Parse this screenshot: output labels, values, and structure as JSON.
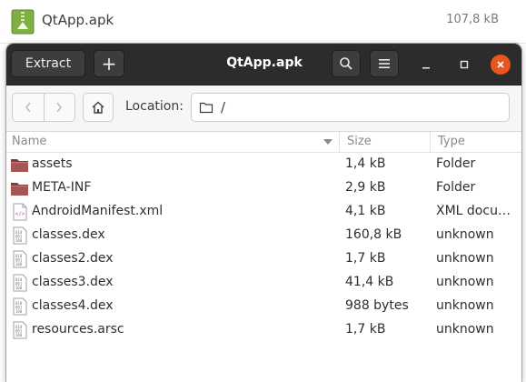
{
  "background_file": {
    "name": "QtApp.apk",
    "size": "107,8 kB"
  },
  "window": {
    "title": "QtApp.apk",
    "extract_label": "Extract",
    "add_label": "+"
  },
  "location": {
    "label": "Location:",
    "path": "/"
  },
  "columns": {
    "name": "Name",
    "size": "Size",
    "type": "Type"
  },
  "files": [
    {
      "name": "assets",
      "size": "1,4 kB",
      "type": "Folder",
      "icon": "folder-icon"
    },
    {
      "name": "META-INF",
      "size": "2,9 kB",
      "type": "Folder",
      "icon": "folder-icon"
    },
    {
      "name": "AndroidManifest.xml",
      "size": "4,1 kB",
      "type": "XML docu…",
      "icon": "xml-file-icon"
    },
    {
      "name": "classes.dex",
      "size": "160,8 kB",
      "type": "unknown",
      "icon": "binary-file-icon"
    },
    {
      "name": "classes2.dex",
      "size": "1,7 kB",
      "type": "unknown",
      "icon": "binary-file-icon"
    },
    {
      "name": "classes3.dex",
      "size": "41,4 kB",
      "type": "unknown",
      "icon": "binary-file-icon"
    },
    {
      "name": "classes4.dex",
      "size": "988 bytes",
      "type": "unknown",
      "icon": "binary-file-icon"
    },
    {
      "name": "resources.arsc",
      "size": "1,7 kB",
      "type": "unknown",
      "icon": "binary-file-icon"
    }
  ],
  "colors": {
    "headerbar": "#2c2c2c",
    "close": "#e95420",
    "folder": "#7a3e3e",
    "apk": "#7fae42"
  }
}
